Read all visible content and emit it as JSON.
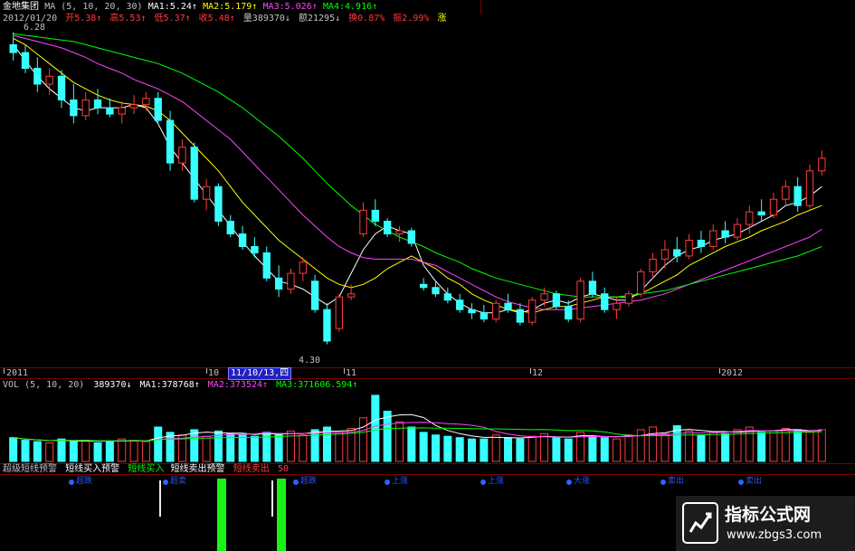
{
  "header": {
    "stock_name": "金地集团",
    "ma_setting": "MA (5, 10, 20, 30)",
    "ma1": "MA1:5.24↑",
    "ma2": "MA2:5.179↑",
    "ma3": "MA3:5.026↑",
    "ma4": "MA4:4.916↑",
    "date": "2012/01/20",
    "open": "开5.38↑",
    "high": "高5.53↑",
    "low": "低5.37↑",
    "close": "收5.48↑",
    "volume": "量389370↓",
    "amount": "额21295↓",
    "turnover": "换0.87%",
    "amplitude": "振2.99%",
    "strength": "涨"
  },
  "price_labels": {
    "top": "6.28",
    "bottom": "4.30"
  },
  "time_axis": {
    "labels": [
      "2011",
      "10",
      "11/10/13,四",
      "11",
      "12",
      "2012"
    ]
  },
  "volume_header": {
    "setting": "VOL (5, 10, 20)",
    "vol": "389370↓",
    "ma1": "MA1:378768↑",
    "ma2": "MA2:373524↑",
    "ma3": "MA3:371606.594↑"
  },
  "indicator_header": {
    "title": "超级短线预警",
    "item1": "短线买入预警",
    "item2": "短线买入",
    "item3": "短线卖出预警",
    "item4": "短线卖出",
    "value": "50"
  },
  "indicator_markers": [
    "超跌",
    "超卖",
    "超跌",
    "上涨",
    "上涨",
    "大涨",
    "卖出",
    "卖出"
  ],
  "watermark": {
    "title": "指标公式网",
    "url": "www.zbgs3.com"
  },
  "colors": {
    "up": "#ff3b3b",
    "down": "#38ffff",
    "ma1": "#ffffff",
    "ma2": "#ffff00",
    "ma3": "#ff44ff",
    "ma4": "#00ff00",
    "grid": "#7a0000"
  },
  "chart_data": {
    "type": "candlestick",
    "description_values": "approximate daily candles read from the price panel",
    "y_range": [
      4.3,
      6.28
    ],
    "candles": [
      {
        "o": 6.2,
        "h": 6.28,
        "l": 6.1,
        "c": 6.15
      },
      {
        "o": 6.15,
        "h": 6.2,
        "l": 6.02,
        "c": 6.05
      },
      {
        "o": 6.05,
        "h": 6.12,
        "l": 5.9,
        "c": 5.95
      },
      {
        "o": 5.95,
        "h": 6.05,
        "l": 5.88,
        "c": 6.0
      },
      {
        "o": 6.0,
        "h": 6.04,
        "l": 5.8,
        "c": 5.85
      },
      {
        "o": 5.85,
        "h": 5.95,
        "l": 5.7,
        "c": 5.75
      },
      {
        "o": 5.75,
        "h": 5.9,
        "l": 5.72,
        "c": 5.85
      },
      {
        "o": 5.85,
        "h": 5.92,
        "l": 5.76,
        "c": 5.8
      },
      {
        "o": 5.8,
        "h": 5.86,
        "l": 5.74,
        "c": 5.76
      },
      {
        "o": 5.76,
        "h": 5.84,
        "l": 5.7,
        "c": 5.8
      },
      {
        "o": 5.8,
        "h": 5.88,
        "l": 5.76,
        "c": 5.82
      },
      {
        "o": 5.82,
        "h": 5.9,
        "l": 5.78,
        "c": 5.86
      },
      {
        "o": 5.86,
        "h": 5.9,
        "l": 5.7,
        "c": 5.72
      },
      {
        "o": 5.72,
        "h": 5.78,
        "l": 5.4,
        "c": 5.45
      },
      {
        "o": 5.45,
        "h": 5.6,
        "l": 5.4,
        "c": 5.55
      },
      {
        "o": 5.55,
        "h": 5.58,
        "l": 5.2,
        "c": 5.22
      },
      {
        "o": 5.22,
        "h": 5.35,
        "l": 5.15,
        "c": 5.3
      },
      {
        "o": 5.3,
        "h": 5.32,
        "l": 5.05,
        "c": 5.08
      },
      {
        "o": 5.08,
        "h": 5.12,
        "l": 4.98,
        "c": 5.0
      },
      {
        "o": 5.0,
        "h": 5.05,
        "l": 4.9,
        "c": 4.92
      },
      {
        "o": 4.92,
        "h": 4.98,
        "l": 4.85,
        "c": 4.88
      },
      {
        "o": 4.88,
        "h": 4.92,
        "l": 4.7,
        "c": 4.72
      },
      {
        "o": 4.72,
        "h": 4.8,
        "l": 4.6,
        "c": 4.65
      },
      {
        "o": 4.65,
        "h": 4.78,
        "l": 4.62,
        "c": 4.75
      },
      {
        "o": 4.75,
        "h": 4.85,
        "l": 4.7,
        "c": 4.82
      },
      {
        "o": 4.7,
        "h": 4.74,
        "l": 4.5,
        "c": 4.52
      },
      {
        "o": 4.52,
        "h": 4.56,
        "l": 4.3,
        "c": 4.32
      },
      {
        "o": 4.4,
        "h": 4.62,
        "l": 4.38,
        "c": 4.6
      },
      {
        "o": 4.6,
        "h": 4.68,
        "l": 4.58,
        "c": 4.62
      },
      {
        "o": 5.0,
        "h": 5.2,
        "l": 4.98,
        "c": 5.15
      },
      {
        "o": 5.15,
        "h": 5.22,
        "l": 5.05,
        "c": 5.08
      },
      {
        "o": 5.08,
        "h": 5.1,
        "l": 4.98,
        "c": 5.0
      },
      {
        "o": 5.0,
        "h": 5.05,
        "l": 4.95,
        "c": 5.02
      },
      {
        "o": 5.02,
        "h": 5.04,
        "l": 4.92,
        "c": 4.94
      },
      {
        "o": 4.68,
        "h": 4.72,
        "l": 4.64,
        "c": 4.66
      },
      {
        "o": 4.66,
        "h": 4.7,
        "l": 4.6,
        "c": 4.62
      },
      {
        "o": 4.62,
        "h": 4.66,
        "l": 4.56,
        "c": 4.58
      },
      {
        "o": 4.58,
        "h": 4.62,
        "l": 4.5,
        "c": 4.52
      },
      {
        "o": 4.52,
        "h": 4.56,
        "l": 4.46,
        "c": 4.5
      },
      {
        "o": 4.5,
        "h": 4.55,
        "l": 4.44,
        "c": 4.46
      },
      {
        "o": 4.46,
        "h": 4.58,
        "l": 4.44,
        "c": 4.56
      },
      {
        "o": 4.56,
        "h": 4.62,
        "l": 4.5,
        "c": 4.52
      },
      {
        "o": 4.52,
        "h": 4.56,
        "l": 4.42,
        "c": 4.44
      },
      {
        "o": 4.44,
        "h": 4.6,
        "l": 4.42,
        "c": 4.58
      },
      {
        "o": 4.58,
        "h": 4.66,
        "l": 4.54,
        "c": 4.62
      },
      {
        "o": 4.62,
        "h": 4.64,
        "l": 4.52,
        "c": 4.54
      },
      {
        "o": 4.54,
        "h": 4.58,
        "l": 4.44,
        "c": 4.46
      },
      {
        "o": 4.46,
        "h": 4.72,
        "l": 4.44,
        "c": 4.7
      },
      {
        "o": 4.7,
        "h": 4.76,
        "l": 4.6,
        "c": 4.62
      },
      {
        "o": 4.62,
        "h": 4.66,
        "l": 4.5,
        "c": 4.52
      },
      {
        "o": 4.52,
        "h": 4.6,
        "l": 4.46,
        "c": 4.56
      },
      {
        "o": 4.56,
        "h": 4.64,
        "l": 4.54,
        "c": 4.62
      },
      {
        "o": 4.62,
        "h": 4.78,
        "l": 4.6,
        "c": 4.76
      },
      {
        "o": 4.76,
        "h": 4.88,
        "l": 4.72,
        "c": 4.84
      },
      {
        "o": 4.84,
        "h": 4.96,
        "l": 4.78,
        "c": 4.9
      },
      {
        "o": 4.9,
        "h": 4.98,
        "l": 4.82,
        "c": 4.86
      },
      {
        "o": 4.86,
        "h": 5.0,
        "l": 4.84,
        "c": 4.96
      },
      {
        "o": 4.96,
        "h": 5.02,
        "l": 4.88,
        "c": 4.92
      },
      {
        "o": 4.92,
        "h": 5.06,
        "l": 4.9,
        "c": 5.02
      },
      {
        "o": 5.02,
        "h": 5.08,
        "l": 4.94,
        "c": 4.98
      },
      {
        "o": 4.98,
        "h": 5.1,
        "l": 4.96,
        "c": 5.06
      },
      {
        "o": 5.06,
        "h": 5.18,
        "l": 5.0,
        "c": 5.14
      },
      {
        "o": 5.14,
        "h": 5.22,
        "l": 5.08,
        "c": 5.12
      },
      {
        "o": 5.12,
        "h": 5.26,
        "l": 5.1,
        "c": 5.22
      },
      {
        "o": 5.22,
        "h": 5.34,
        "l": 5.18,
        "c": 5.3
      },
      {
        "o": 5.3,
        "h": 5.36,
        "l": 5.14,
        "c": 5.18
      },
      {
        "o": 5.18,
        "h": 5.44,
        "l": 5.16,
        "c": 5.4
      },
      {
        "o": 5.4,
        "h": 5.53,
        "l": 5.37,
        "c": 5.48
      }
    ],
    "ma_series": [
      {
        "name": "MA1",
        "color": "ma1",
        "values": [
          6.2,
          6.1,
          6.0,
          5.92,
          5.86,
          5.8,
          5.78,
          5.8,
          5.8,
          5.8,
          5.82,
          5.8,
          5.7,
          5.55,
          5.45,
          5.35,
          5.25,
          5.15,
          5.05,
          4.95,
          4.86,
          4.78,
          4.7,
          4.68,
          4.65,
          4.6,
          4.55,
          4.6,
          4.75,
          4.9,
          5.0,
          5.05,
          5.02,
          5.0,
          4.8,
          4.7,
          4.62,
          4.56,
          4.52,
          4.5,
          4.5,
          4.52,
          4.5,
          4.52,
          4.56,
          4.58,
          4.56,
          4.6,
          4.62,
          4.6,
          4.58,
          4.58,
          4.64,
          4.72,
          4.8,
          4.86,
          4.9,
          4.92,
          4.96,
          4.98,
          5.0,
          5.04,
          5.08,
          5.12,
          5.18,
          5.2,
          5.24,
          5.3
        ]
      },
      {
        "name": "MA2",
        "color": "ma2",
        "values": [
          6.24,
          6.2,
          6.14,
          6.08,
          6.02,
          5.96,
          5.92,
          5.88,
          5.85,
          5.83,
          5.82,
          5.81,
          5.78,
          5.72,
          5.64,
          5.56,
          5.48,
          5.4,
          5.3,
          5.2,
          5.12,
          5.04,
          4.96,
          4.9,
          4.84,
          4.78,
          4.72,
          4.68,
          4.66,
          4.68,
          4.72,
          4.78,
          4.82,
          4.86,
          4.82,
          4.78,
          4.72,
          4.68,
          4.62,
          4.58,
          4.55,
          4.52,
          4.51,
          4.5,
          4.52,
          4.54,
          4.54,
          4.56,
          4.58,
          4.6,
          4.6,
          4.6,
          4.62,
          4.66,
          4.7,
          4.74,
          4.8,
          4.84,
          4.88,
          4.92,
          4.95,
          4.98,
          5.02,
          5.05,
          5.08,
          5.12,
          5.15,
          5.18
        ]
      },
      {
        "name": "MA3",
        "color": "ma3",
        "values": [
          6.26,
          6.24,
          6.22,
          6.2,
          6.18,
          6.15,
          6.12,
          6.08,
          6.05,
          6.02,
          5.98,
          5.95,
          5.92,
          5.88,
          5.84,
          5.78,
          5.72,
          5.66,
          5.6,
          5.52,
          5.44,
          5.36,
          5.28,
          5.2,
          5.12,
          5.05,
          4.98,
          4.92,
          4.88,
          4.85,
          4.84,
          4.84,
          4.84,
          4.84,
          4.82,
          4.8,
          4.76,
          4.72,
          4.68,
          4.64,
          4.6,
          4.57,
          4.55,
          4.53,
          4.52,
          4.52,
          4.52,
          4.53,
          4.54,
          4.55,
          4.56,
          4.57,
          4.58,
          4.6,
          4.62,
          4.65,
          4.68,
          4.71,
          4.74,
          4.77,
          4.8,
          4.83,
          4.86,
          4.89,
          4.92,
          4.95,
          4.98,
          5.03
        ]
      },
      {
        "name": "MA4",
        "color": "ma4",
        "values": [
          6.27,
          6.26,
          6.25,
          6.24,
          6.23,
          6.22,
          6.2,
          6.18,
          6.16,
          6.14,
          6.12,
          6.1,
          6.08,
          6.05,
          6.02,
          5.98,
          5.94,
          5.9,
          5.85,
          5.8,
          5.74,
          5.68,
          5.62,
          5.55,
          5.48,
          5.4,
          5.32,
          5.25,
          5.18,
          5.12,
          5.06,
          5.02,
          4.98,
          4.95,
          4.92,
          4.88,
          4.85,
          4.82,
          4.78,
          4.75,
          4.72,
          4.7,
          4.68,
          4.66,
          4.64,
          4.62,
          4.61,
          4.6,
          4.6,
          4.6,
          4.6,
          4.61,
          4.62,
          4.63,
          4.64,
          4.66,
          4.68,
          4.7,
          4.72,
          4.74,
          4.76,
          4.78,
          4.8,
          4.82,
          4.84,
          4.86,
          4.89,
          4.92
        ]
      }
    ],
    "volume": [
      180,
      160,
      150,
      140,
      170,
      150,
      160,
      140,
      150,
      170,
      160,
      150,
      260,
      220,
      200,
      240,
      190,
      230,
      210,
      200,
      190,
      220,
      210,
      230,
      200,
      240,
      260,
      220,
      250,
      330,
      500,
      380,
      300,
      260,
      220,
      200,
      190,
      180,
      170,
      170,
      200,
      180,
      170,
      190,
      210,
      180,
      170,
      220,
      190,
      180,
      170,
      200,
      240,
      260,
      210,
      270,
      230,
      200,
      220,
      210,
      240,
      260,
      220,
      230,
      250,
      240,
      220,
      240
    ]
  }
}
